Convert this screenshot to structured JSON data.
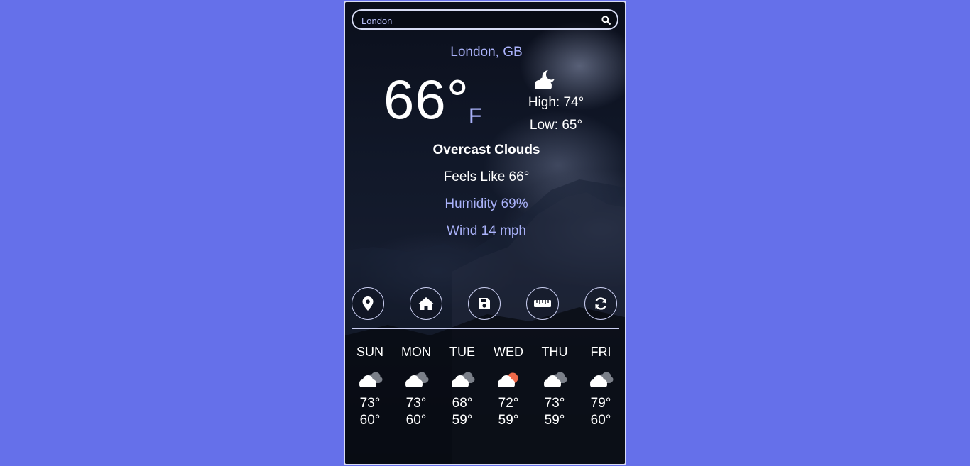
{
  "search": {
    "value": "London",
    "icon": "search-icon"
  },
  "current": {
    "location": "London, GB",
    "temperature": "66°",
    "unit": "F",
    "condition_icon": "cloud-moon-icon",
    "high": "High: 74°",
    "low": "Low: 65°",
    "description": "Overcast Clouds",
    "feels_like": "Feels Like 66°",
    "humidity": "Humidity 69%",
    "wind": "Wind 14 mph"
  },
  "actions": [
    {
      "icon": "map-marker-icon"
    },
    {
      "icon": "home-icon"
    },
    {
      "icon": "save-icon"
    },
    {
      "icon": "ruler-icon"
    },
    {
      "icon": "refresh-icon"
    }
  ],
  "forecast": [
    {
      "day": "SUN",
      "high": "73°",
      "low": "60°",
      "icon": "clouds-icon"
    },
    {
      "day": "MON",
      "high": "73°",
      "low": "60°",
      "icon": "clouds-icon"
    },
    {
      "day": "TUE",
      "high": "68°",
      "low": "59°",
      "icon": "clouds-icon"
    },
    {
      "day": "WED",
      "high": "72°",
      "low": "59°",
      "icon": "cloud-sun-icon"
    },
    {
      "day": "THU",
      "high": "73°",
      "low": "59°",
      "icon": "clouds-icon"
    },
    {
      "day": "FRI",
      "high": "79°",
      "low": "60°",
      "icon": "clouds-icon"
    }
  ],
  "colors": {
    "page_background": "#6570ea",
    "accent_text": "#aab2fa",
    "primary_text": "#ffffff",
    "border": "#d8dcf5",
    "sun": "#f06a4a"
  }
}
